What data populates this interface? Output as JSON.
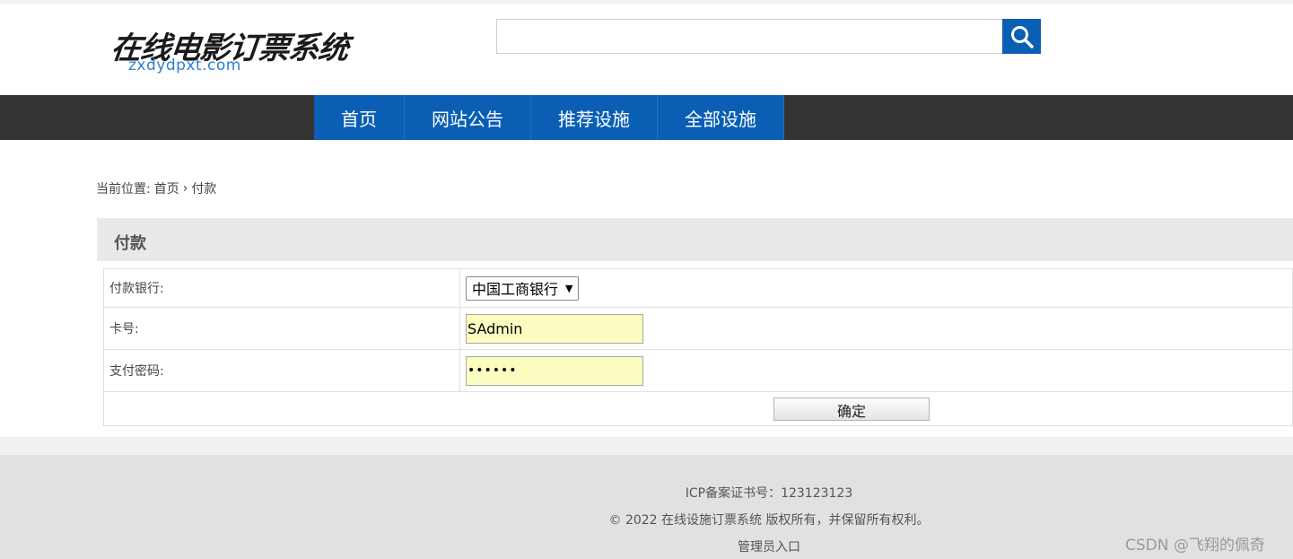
{
  "header": {
    "logo_cn": "在线电影订票系统",
    "logo_en": "zxdydpxt.com",
    "search": {
      "value": "",
      "placeholder": ""
    }
  },
  "nav": {
    "items": [
      {
        "label": "首页"
      },
      {
        "label": "网站公告"
      },
      {
        "label": "推荐设施"
      },
      {
        "label": "全部设施"
      }
    ]
  },
  "breadcrumb": {
    "prefix": "当前位置:",
    "home": "首页",
    "separator": "›",
    "current": "付款"
  },
  "panel": {
    "title": "付款",
    "fields": {
      "bank_label": "付款银行:",
      "bank_value": "中国工商银行",
      "card_label": "卡号:",
      "card_value": "SAdmin",
      "password_label": "支付密码:",
      "password_value": "••••••"
    },
    "confirm_label": "确定"
  },
  "footer": {
    "icp": "ICP备案证书号：123123123",
    "copyright": "© 2022 在线设施订票系统 版权所有，并保留所有权利。",
    "admin_link": "管理员入口"
  },
  "watermark": "CSDN @飞翔的佩奇",
  "colors": {
    "nav_blue": "#0a5fb4",
    "nav_bar": "#333333",
    "input_fill": "#fbfdc0",
    "logo_en": "#2a7fd1"
  },
  "icons": {
    "search": "search-icon",
    "select_caret": "caret-down-icon"
  }
}
